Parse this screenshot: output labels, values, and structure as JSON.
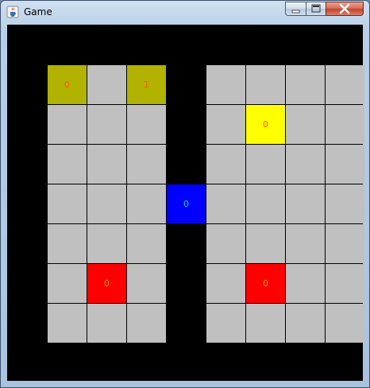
{
  "window": {
    "title": "Game"
  },
  "colors": {
    "empty": "#c0c0c0",
    "olive": "#b2b200",
    "yellow": "#ffff00",
    "blue": "#0000ff",
    "red": "#ff0000",
    "label_orange": "#ff5500",
    "label_gold": "#e0a000",
    "label_cyan": "#20c8c8"
  },
  "icons": {
    "app": "java-cup-icon",
    "minimize": "minimize-icon",
    "maximize": "maximize-icon",
    "close": "close-icon"
  },
  "board": {
    "columns": 8,
    "rows": 7,
    "special_cells": [
      {
        "col": 0,
        "row": 0,
        "color": "olive",
        "label": "0",
        "label_color": "label_orange"
      },
      {
        "col": 2,
        "row": 0,
        "color": "olive",
        "label": "1",
        "label_color": "label_orange"
      },
      {
        "col": 5,
        "row": 1,
        "color": "yellow",
        "label": "0",
        "label_color": "label_orange"
      },
      {
        "col": 3,
        "row": 3,
        "color": "blue",
        "label": "0",
        "label_color": "label_cyan"
      },
      {
        "col": 1,
        "row": 5,
        "color": "red",
        "label": "0",
        "label_color": "label_gold"
      },
      {
        "col": 5,
        "row": 5,
        "color": "red",
        "label": "0",
        "label_color": "label_gold"
      }
    ]
  }
}
